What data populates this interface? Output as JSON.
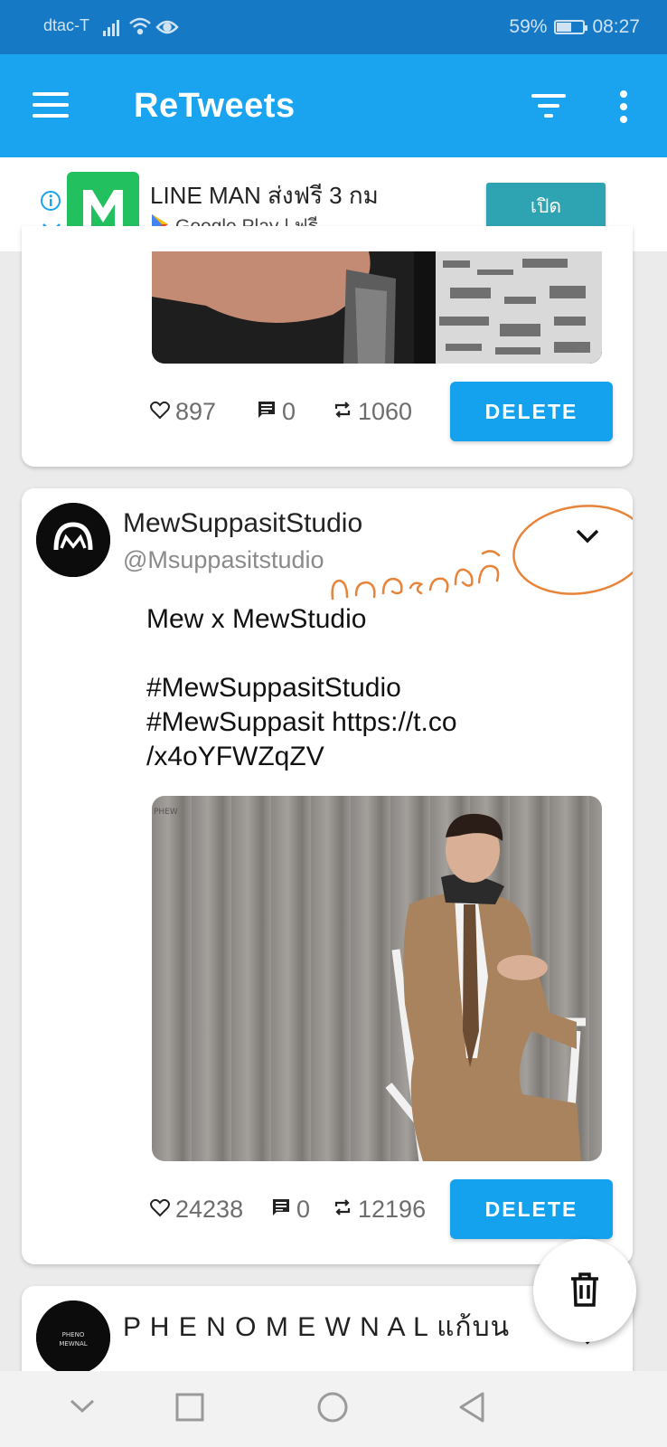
{
  "status_bar": {
    "carrier": "dtac-T",
    "battery_percent": "59%",
    "battery_level": 0.59,
    "time": "08:27"
  },
  "app_bar": {
    "title": "ReTweets",
    "icons": [
      "menu-icon",
      "filter-icon",
      "more-vert-icon"
    ]
  },
  "ad": {
    "title": "LINE MAN ส่งฟรี 3 กม",
    "store": "Google Play",
    "price": "| ฟรี",
    "button": "เปิด",
    "brand_color": "#22c05f"
  },
  "tweets": [
    {
      "likes": "897",
      "comments": "0",
      "retweets": "1060",
      "delete_label": "DELETE"
    },
    {
      "name": "MewSuppasitStudio",
      "handle": "@Msuppasitstudio",
      "text": "Mew x MewStudio\n\n#MewSuppasitStudio\n#MewSuppasit https://t.co\n/x4oYFWZqZV",
      "likes": "24238",
      "comments": "0",
      "retweets": "12196",
      "delete_label": "DELETE",
      "annotation": "กดตรงนี้"
    },
    {
      "name": "P H E N O M E W N A L แก้บน"
    }
  ],
  "colors": {
    "status_bar": "#1579c5",
    "app_bar": "#1aa4ef",
    "delete_button": "#14a2ee",
    "annotation": "#e8833a"
  }
}
